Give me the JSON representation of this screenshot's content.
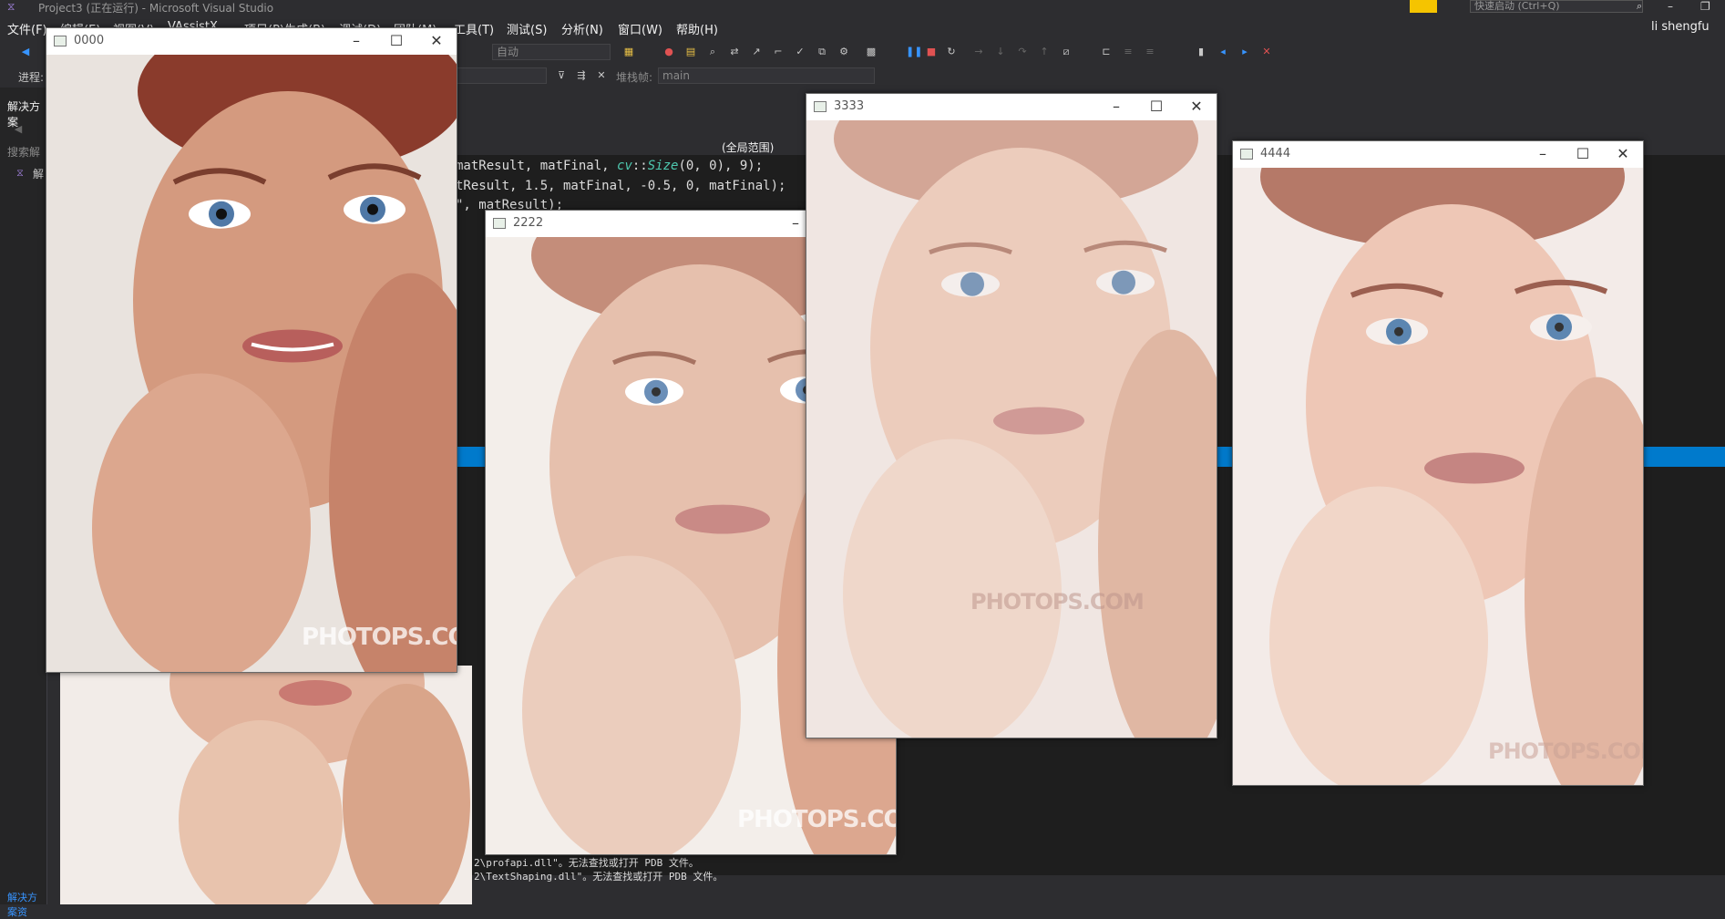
{
  "vs": {
    "title": "Project3 (正在运行) - Microsoft Visual Studio",
    "quick_launch_placeholder": "快速启动 (Ctrl+Q)",
    "user": "li shengfu",
    "menu": [
      "文件(F)",
      "编辑(E)",
      "视图(V)",
      "VAssistX",
      "项目(P)",
      "生成(B)",
      "调试(D)",
      "团队(M)",
      "工具(T)",
      "测试(S)",
      "分析(N)",
      "窗口(W)",
      "帮助(H)"
    ],
    "toolbar": {
      "config_combo": "自动",
      "process_label": "进程:",
      "stack_label": "堆栈帧:",
      "stack_value": "main"
    },
    "solution_panel": {
      "header": "解决方案",
      "search": "搜索解",
      "tree_root": "解",
      "bottom_tab": "解决方案资"
    },
    "editor": {
      "scope": "(全局范围)",
      "code_lines": [
        "matResult, matFinal, cv::Size(0, 0), 9);",
        "tResult, 1.5, matFinal, -0.5, 0, matFinal);",
        "\", matResult);"
      ],
      "output_lines": [
        "2\\profapi.dll\"。无法查找或打开 PDB 文件。",
        "2\\TextShaping.dll\"。无法查找或打开 PDB 文件。"
      ]
    }
  },
  "windows": [
    {
      "title": "0000",
      "watermark": "PHOTOPS.COM"
    },
    {
      "title": "2222",
      "watermark": "PHOTOPS.COM"
    },
    {
      "title": "3333",
      "watermark": "PHOTOPS.COM"
    },
    {
      "title": "4444",
      "watermark": "PHOTOPS.COM"
    }
  ],
  "colors": {
    "vs_bg": "#2d2d30",
    "accent": "#007acc",
    "notify": "#f5c400"
  }
}
